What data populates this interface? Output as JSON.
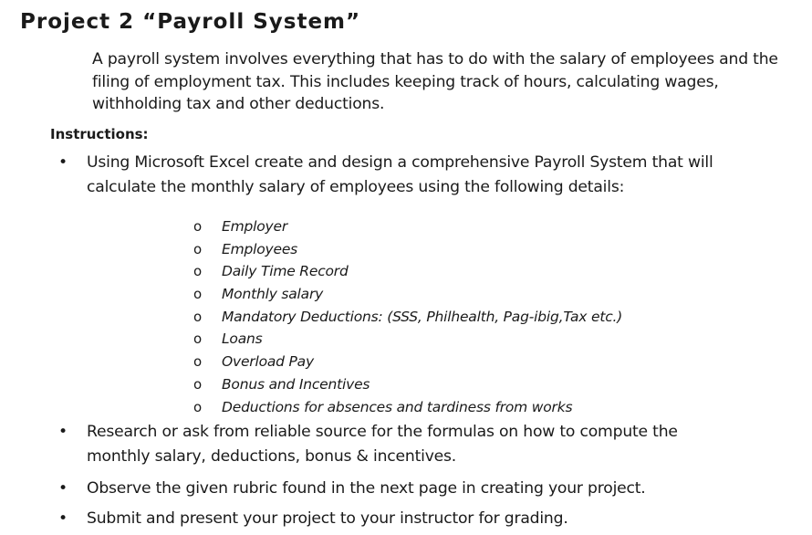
{
  "document": {
    "title": "Project 2 “Payroll System”",
    "intro": "A payroll system involves everything that has to do with the salary of employees and the filing of employment tax. This includes keeping track of hours, calculating wages, withholding tax and other deductions.",
    "instructions_heading": "Instructions:",
    "bullet_symbol": "•",
    "sub_bullet_symbol": "o",
    "bullets": [
      {
        "text": "Using Microsoft Excel create and design a comprehensive Payroll System that will calculate the monthly salary of employees using the following details:"
      },
      {
        "text": "Research or ask from reliable source for the formulas on how to compute the monthly salary, deductions, bonus & incentives."
      },
      {
        "text": "Observe the given rubric found in the next page in creating your project."
      },
      {
        "text": "Submit and present your project to your instructor for grading."
      }
    ],
    "sub_items": [
      "Employer",
      "Employees",
      "Daily Time Record",
      "Monthly salary",
      "Mandatory Deductions: (SSS, Philhealth, Pag-ibig,Tax etc.)",
      "Loans",
      "Overload Pay",
      "Bonus and Incentives",
      "Deductions for absences and tardiness from works"
    ]
  }
}
